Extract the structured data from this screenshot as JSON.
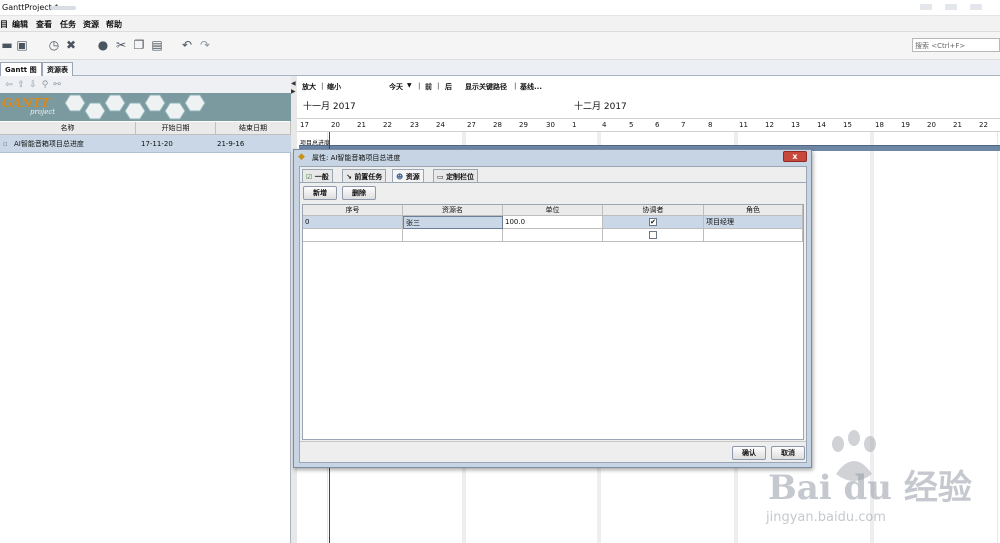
{
  "window": {
    "title": "GanttProject *"
  },
  "menu": [
    "目",
    "编辑",
    "查看",
    "任务",
    "资源",
    "帮助"
  ],
  "toolbar": {
    "icons": [
      "save-icon",
      "save-as-icon",
      "history-icon",
      "delete-icon",
      "info-icon",
      "cut-icon",
      "copy-icon",
      "paste-icon",
      "undo-icon",
      "redo-icon"
    ],
    "search_placeholder": "搜索 <Ctrl+F>"
  },
  "view_tabs": [
    "Gantt 图",
    "资源表"
  ],
  "logo": {
    "brand": "GANTT",
    "sub": "project"
  },
  "task_table": {
    "columns": [
      "名称",
      "开始日期",
      "结束日期"
    ],
    "rows": [
      {
        "name": "AI智能音箱项目总进度",
        "start": "17-11-20",
        "end": "21-9-16"
      }
    ]
  },
  "chart": {
    "zoom_in": "放大",
    "zoom_out": "缩小",
    "today": "今天",
    "prev": "前",
    "next": "后",
    "critical_path": "显示关键路径",
    "baseline": "基线...",
    "months": [
      "十一月 2017",
      "十二月 2017"
    ],
    "days": [
      "17",
      "20",
      "21",
      "22",
      "23",
      "24",
      "27",
      "28",
      "29",
      "30",
      "1",
      "4",
      "5",
      "6",
      "7",
      "8",
      "11",
      "12",
      "13",
      "14",
      "15",
      "18",
      "19",
      "20",
      "21",
      "22"
    ],
    "task_label": "项目总进度"
  },
  "dialog": {
    "title": "属性: AI智能音箱项目总进度",
    "close": "x",
    "tabs": [
      "一般",
      "前置任务",
      "资源",
      "定制栏位"
    ],
    "add_button": "新增",
    "delete_button": "删除",
    "columns": [
      "序号",
      "资源名",
      "单位",
      "协调者",
      "角色"
    ],
    "rows": [
      {
        "id": "0",
        "resource": "张三",
        "unit": "100.0",
        "coordinator": true,
        "role": "项目经理"
      },
      {
        "id": "",
        "resource": "",
        "unit": "",
        "coordinator": false,
        "role": ""
      }
    ],
    "ok": "确认",
    "cancel": "取消"
  },
  "watermark": {
    "brand": "Bai du 经验",
    "url": "jingyan.baidu.com"
  },
  "colors": {
    "selection": "#c9d7e6",
    "task_bar": "#6e87a5",
    "today_line": "#2b3db5",
    "dialog_frame": "#c6d4e4"
  }
}
